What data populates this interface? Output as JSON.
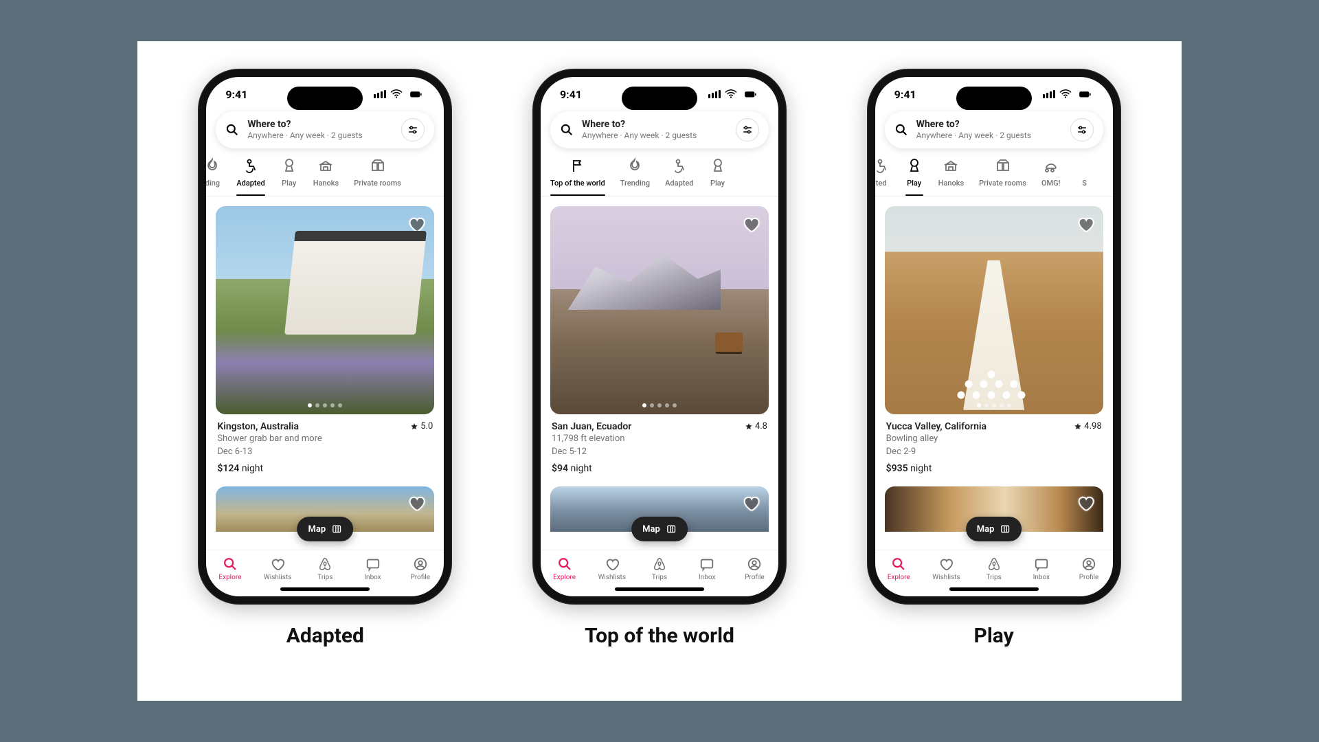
{
  "status": {
    "time": "9:41"
  },
  "search": {
    "title": "Where to?",
    "subtitle": "Anywhere · Any week · 2 guests"
  },
  "map_label": "Map",
  "bottom_nav": [
    {
      "label": "Explore"
    },
    {
      "label": "Wishlists"
    },
    {
      "label": "Trips"
    },
    {
      "label": "Inbox"
    },
    {
      "label": "Profile"
    }
  ],
  "phones": [
    {
      "caption": "Adapted",
      "active_tab": 1,
      "tabs": [
        {
          "label": "ding",
          "partial": true
        },
        {
          "label": "Adapted"
        },
        {
          "label": "Play"
        },
        {
          "label": "Hanoks"
        },
        {
          "label": "Private rooms"
        }
      ],
      "listing": {
        "location": "Kingston, Australia",
        "rating": "5.0",
        "subtitle": "Shower grab bar and more",
        "dates": "Dec 6-13",
        "price_amount": "$124",
        "price_unit": "night"
      }
    },
    {
      "caption": "Top of the world",
      "active_tab": 0,
      "tabs": [
        {
          "label": "Top of the world"
        },
        {
          "label": "Trending"
        },
        {
          "label": "Adapted"
        },
        {
          "label": "Play"
        }
      ],
      "listing": {
        "location": "San Juan, Ecuador",
        "rating": "4.8",
        "subtitle": "11,798 ft elevation",
        "dates": "Dec 5-12",
        "price_amount": "$94",
        "price_unit": "night"
      }
    },
    {
      "caption": "Play",
      "active_tab": 1,
      "tabs": [
        {
          "label": "ted",
          "partial": true
        },
        {
          "label": "Play"
        },
        {
          "label": "Hanoks"
        },
        {
          "label": "Private rooms"
        },
        {
          "label": "OMG!"
        },
        {
          "label": "S",
          "partial": true
        }
      ],
      "listing": {
        "location": "Yucca Valley, California",
        "rating": "4.98",
        "subtitle": "Bowling alley",
        "dates": "Dec 2-9",
        "price_amount": "$935",
        "price_unit": "night"
      }
    }
  ]
}
